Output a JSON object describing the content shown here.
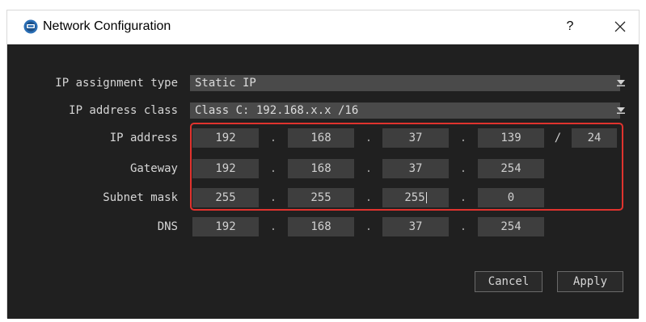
{
  "window": {
    "title": "Network Configuration",
    "help_label": "?",
    "close_label": "✕"
  },
  "labels": {
    "ip_assignment_type": "IP assignment type",
    "ip_address_class": "IP address class",
    "ip_address": "IP address",
    "gateway": "Gateway",
    "subnet_mask": "Subnet mask",
    "dns": "DNS"
  },
  "combos": {
    "ip_assignment_type": "Static IP",
    "ip_address_class": "Class C: 192.168.x.x /16"
  },
  "separators": {
    "dot": ".",
    "slash": "/"
  },
  "ip_address": {
    "octets": [
      "192",
      "168",
      "37",
      "139"
    ],
    "prefix": "24"
  },
  "gateway": {
    "octets": [
      "192",
      "168",
      "37",
      "254"
    ]
  },
  "subnet_mask": {
    "octets": [
      "255",
      "255",
      "255",
      "0"
    ]
  },
  "dns": {
    "octets": [
      "192",
      "168",
      "37",
      "254"
    ]
  },
  "buttons": {
    "cancel": "Cancel",
    "apply": "Apply"
  },
  "colors": {
    "highlight": "#e0332e",
    "panel": "#202020",
    "field": "#3e3e3e"
  }
}
